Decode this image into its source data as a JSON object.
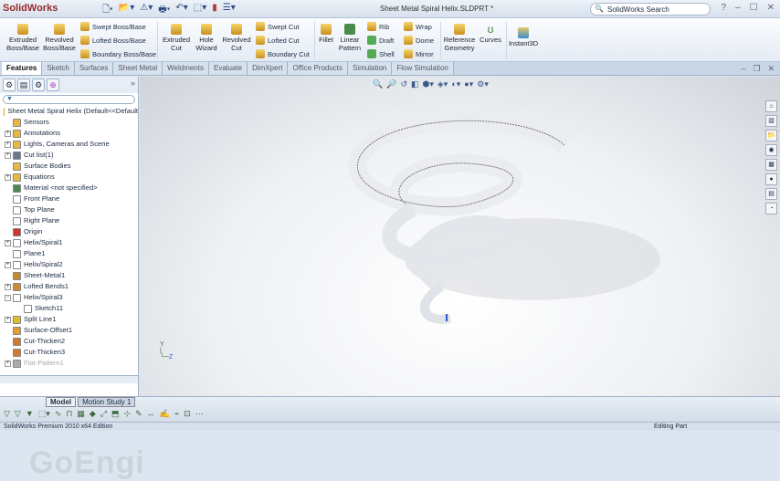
{
  "app": {
    "name": "SolidWorks",
    "document_title": "Sheet Metal Spiral Helix.SLDPRT *",
    "search_placeholder": "SolidWorks Search",
    "help": "?"
  },
  "ribbon": {
    "large": [
      {
        "label": "Extruded Boss/Base"
      },
      {
        "label": "Revolved Boss/Base"
      },
      {
        "label": "Extruded Cut"
      },
      {
        "label": "Hole Wizard"
      },
      {
        "label": "Revolved Cut"
      },
      {
        "label": "Fillet"
      },
      {
        "label": "Linear Pattern"
      },
      {
        "label": "Reference Geometry"
      },
      {
        "label": "Curves"
      },
      {
        "label": "Instant3D"
      }
    ],
    "small": [
      {
        "label": "Swept Boss/Base"
      },
      {
        "label": "Lofted Boss/Base"
      },
      {
        "label": "Boundary Boss/Base"
      },
      {
        "label": "Swept Cut"
      },
      {
        "label": "Lofted Cut"
      },
      {
        "label": "Boundary Cut"
      },
      {
        "label": "Rib"
      },
      {
        "label": "Draft"
      },
      {
        "label": "Shell"
      },
      {
        "label": "Wrap"
      },
      {
        "label": "Dome"
      },
      {
        "label": "Mirror"
      }
    ]
  },
  "tabs": [
    "Features",
    "Sketch",
    "Surfaces",
    "Sheet Metal",
    "Weldments",
    "Evaluate",
    "DimXpert",
    "Office Products",
    "Simulation",
    "Flow Simulation"
  ],
  "tree": {
    "root": "Sheet Metal Spiral Helix  (Default<<Default",
    "items": [
      {
        "label": "Sensors",
        "exp": false,
        "color": "#e8b840"
      },
      {
        "label": "Annotations",
        "exp": true,
        "color": "#e8b840"
      },
      {
        "label": "Lights, Cameras and Scene",
        "exp": true,
        "color": "#e8b840"
      },
      {
        "label": "Cut list(1)",
        "exp": true,
        "color": "#6a7a8a"
      },
      {
        "label": "Surface Bodies",
        "exp": false,
        "color": "#e8b840"
      },
      {
        "label": "Equations",
        "exp": true,
        "color": "#e8b840"
      },
      {
        "label": "Material <not specified>",
        "exp": false,
        "color": "#4a8a4a"
      },
      {
        "label": "Front Plane",
        "exp": false,
        "color": "#ffffff"
      },
      {
        "label": "Top Plane",
        "exp": false,
        "color": "#ffffff"
      },
      {
        "label": "Right Plane",
        "exp": false,
        "color": "#ffffff"
      },
      {
        "label": "Origin",
        "exp": false,
        "color": "#cc3333"
      },
      {
        "label": "Helix/Spiral1",
        "exp": true,
        "color": "#ffffff"
      },
      {
        "label": "Plane1",
        "exp": false,
        "color": "#ffffff"
      },
      {
        "label": "Helix/Spiral2",
        "exp": true,
        "color": "#ffffff"
      },
      {
        "label": "Sheet-Metal1",
        "exp": false,
        "color": "#c88a30"
      },
      {
        "label": "Lofted Bends1",
        "exp": true,
        "color": "#d08a30"
      },
      {
        "label": "Helix/Spiral3",
        "exp": "open",
        "color": "#ffffff"
      },
      {
        "label": "Sketch11",
        "exp": false,
        "color": "#ffffff",
        "indent": true
      },
      {
        "label": "Split Line1",
        "exp": true,
        "color": "#d8c030"
      },
      {
        "label": "Surface-Offset1",
        "exp": false,
        "color": "#e0a030"
      },
      {
        "label": "Cut-Thicken2",
        "exp": false,
        "color": "#d07a30"
      },
      {
        "label": "Cut-Thicken3",
        "exp": false,
        "color": "#d07a30"
      },
      {
        "label": "Flat-Pattern1",
        "exp": true,
        "color": "#aaaaaa",
        "dim": true
      }
    ]
  },
  "bottom_tabs": [
    "Model",
    "Motion Study 1"
  ],
  "status": {
    "edition": "SolidWorks Premium 2010 x64 Edition",
    "mode": "Editing Part"
  },
  "watermark": "GoEngineer",
  "axes": {
    "y": "Y",
    "z": "Z"
  }
}
